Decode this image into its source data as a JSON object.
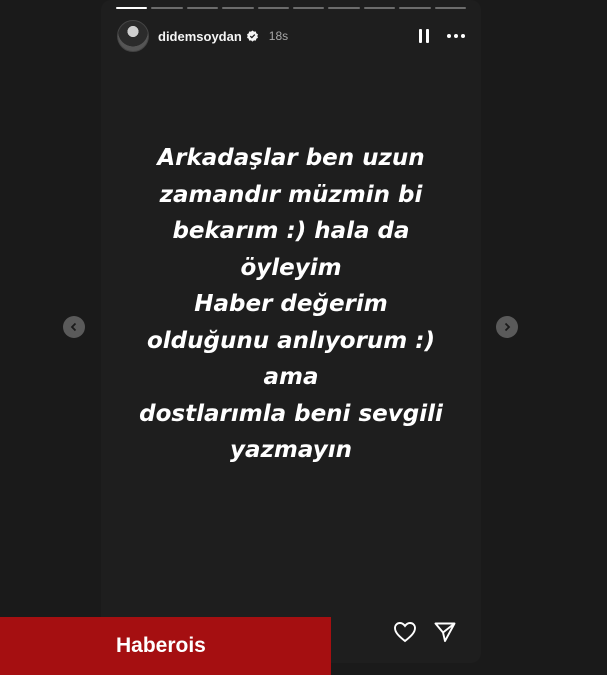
{
  "story": {
    "username": "didemsoydan",
    "time_ago": "18s",
    "progress_segments": 10,
    "progress_completed": 1,
    "text": "Arkadaşlar ben uzun\nzamandır müzmin bi\nbekarım :) hala da\nöyleyim\nHaber değerim\nolduğunu anlıyorum :)\nama\ndostlarımla  beni sevgili\nyazmayın"
  },
  "icons": {
    "verified": "verified-badge-icon",
    "pause": "pause-icon",
    "more": "more-options-icon",
    "like": "heart-icon",
    "share": "send-icon",
    "prev": "chevron-left-icon",
    "next": "chevron-right-icon"
  },
  "watermark": {
    "text": "Haberois"
  },
  "colors": {
    "watermark_bg": "#a50f11",
    "background": "#1a1a1a",
    "story_bg": "#1e1e1e"
  }
}
